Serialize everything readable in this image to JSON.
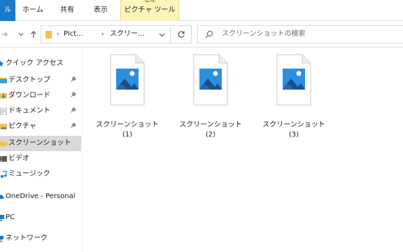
{
  "ribbon": {
    "tabs": {
      "file": "ル",
      "home": "ホーム",
      "share": "共有",
      "view": "表示",
      "picture_tools": "ピクチャ ツール"
    },
    "context_label": "管理"
  },
  "address": {
    "breadcrumbs": [
      "Pict...",
      "スクリー..."
    ]
  },
  "search": {
    "placeholder": "スクリーンショットの検索"
  },
  "sidebar": {
    "items": [
      {
        "label": "クイック アクセス",
        "icon": "star-icon"
      },
      {
        "label": "デスクトップ",
        "icon": "desktop-folder-icon",
        "pinned": true
      },
      {
        "label": "ダウンロード",
        "icon": "download-icon",
        "pinned": true
      },
      {
        "label": "ドキュメント",
        "icon": "document-icon",
        "pinned": true
      },
      {
        "label": "ピクチャ",
        "icon": "pictures-icon",
        "pinned": true
      },
      {
        "label": "スクリーンショット",
        "icon": "folder-icon",
        "selected": true
      },
      {
        "label": "ビデオ",
        "icon": "video-icon"
      },
      {
        "label": "ミュージック",
        "icon": "music-icon"
      },
      {
        "label": "OneDrive - Personal",
        "icon": "cloud-icon"
      },
      {
        "label": "PC",
        "icon": "pc-icon"
      },
      {
        "label": "ネットワーク",
        "icon": "network-icon"
      }
    ],
    "pin_glyph": "📌"
  },
  "files": [
    {
      "name_line1": "スクリーンショット",
      "name_line2": "(1)",
      "icon": "image-file-icon"
    },
    {
      "name_line1": "スクリーンショット",
      "name_line2": "(2)",
      "icon": "image-file-icon"
    },
    {
      "name_line1": "スクリーンショット",
      "name_line2": "(3)",
      "icon": "image-file-icon"
    }
  ],
  "colors": {
    "file_tab": "#1979ca",
    "picture_tools_tab": "#fcf4b8",
    "selected_row": "#d9d9d9",
    "thumb_blue": "#1e7fd6"
  }
}
